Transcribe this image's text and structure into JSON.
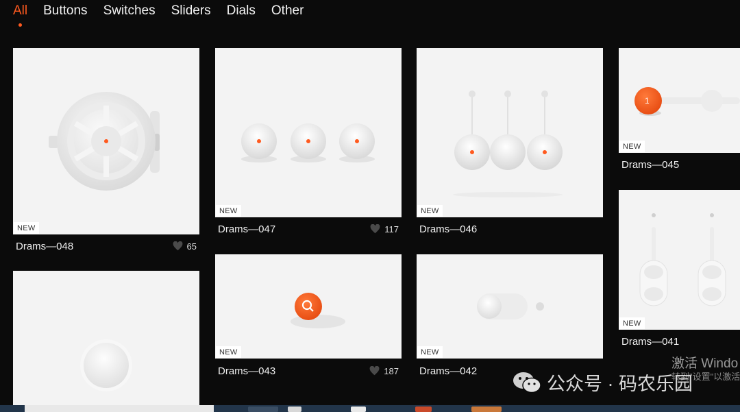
{
  "nav": {
    "tabs": [
      {
        "label": "All",
        "active": true
      },
      {
        "label": "Buttons"
      },
      {
        "label": "Switches"
      },
      {
        "label": "Sliders"
      },
      {
        "label": "Dials"
      },
      {
        "label": "Other"
      }
    ]
  },
  "cards": {
    "c048": {
      "title": "Drams—048",
      "badge": "NEW",
      "likes": "65"
    },
    "c047": {
      "title": "Drams—047",
      "badge": "NEW",
      "likes": "117"
    },
    "c046": {
      "title": "Drams—046",
      "badge": "NEW"
    },
    "c045": {
      "title": "Drams—045",
      "badge": "NEW",
      "knob_label": "1"
    },
    "c043": {
      "title": "Drams—043",
      "badge": "NEW",
      "likes": "187"
    },
    "c042": {
      "title": "Drams—042",
      "badge": "NEW"
    },
    "c041": {
      "title": "Drams—041",
      "badge": "NEW"
    }
  },
  "overlay": {
    "activate_windows": "激活 Windo",
    "activate_hint": "转到\"设置\"以激活",
    "watermark": "公众号 · 码农乐园"
  },
  "colors": {
    "accent": "#ff5a1f",
    "background": "#0b0b0b",
    "card": "#f3f3f3"
  }
}
